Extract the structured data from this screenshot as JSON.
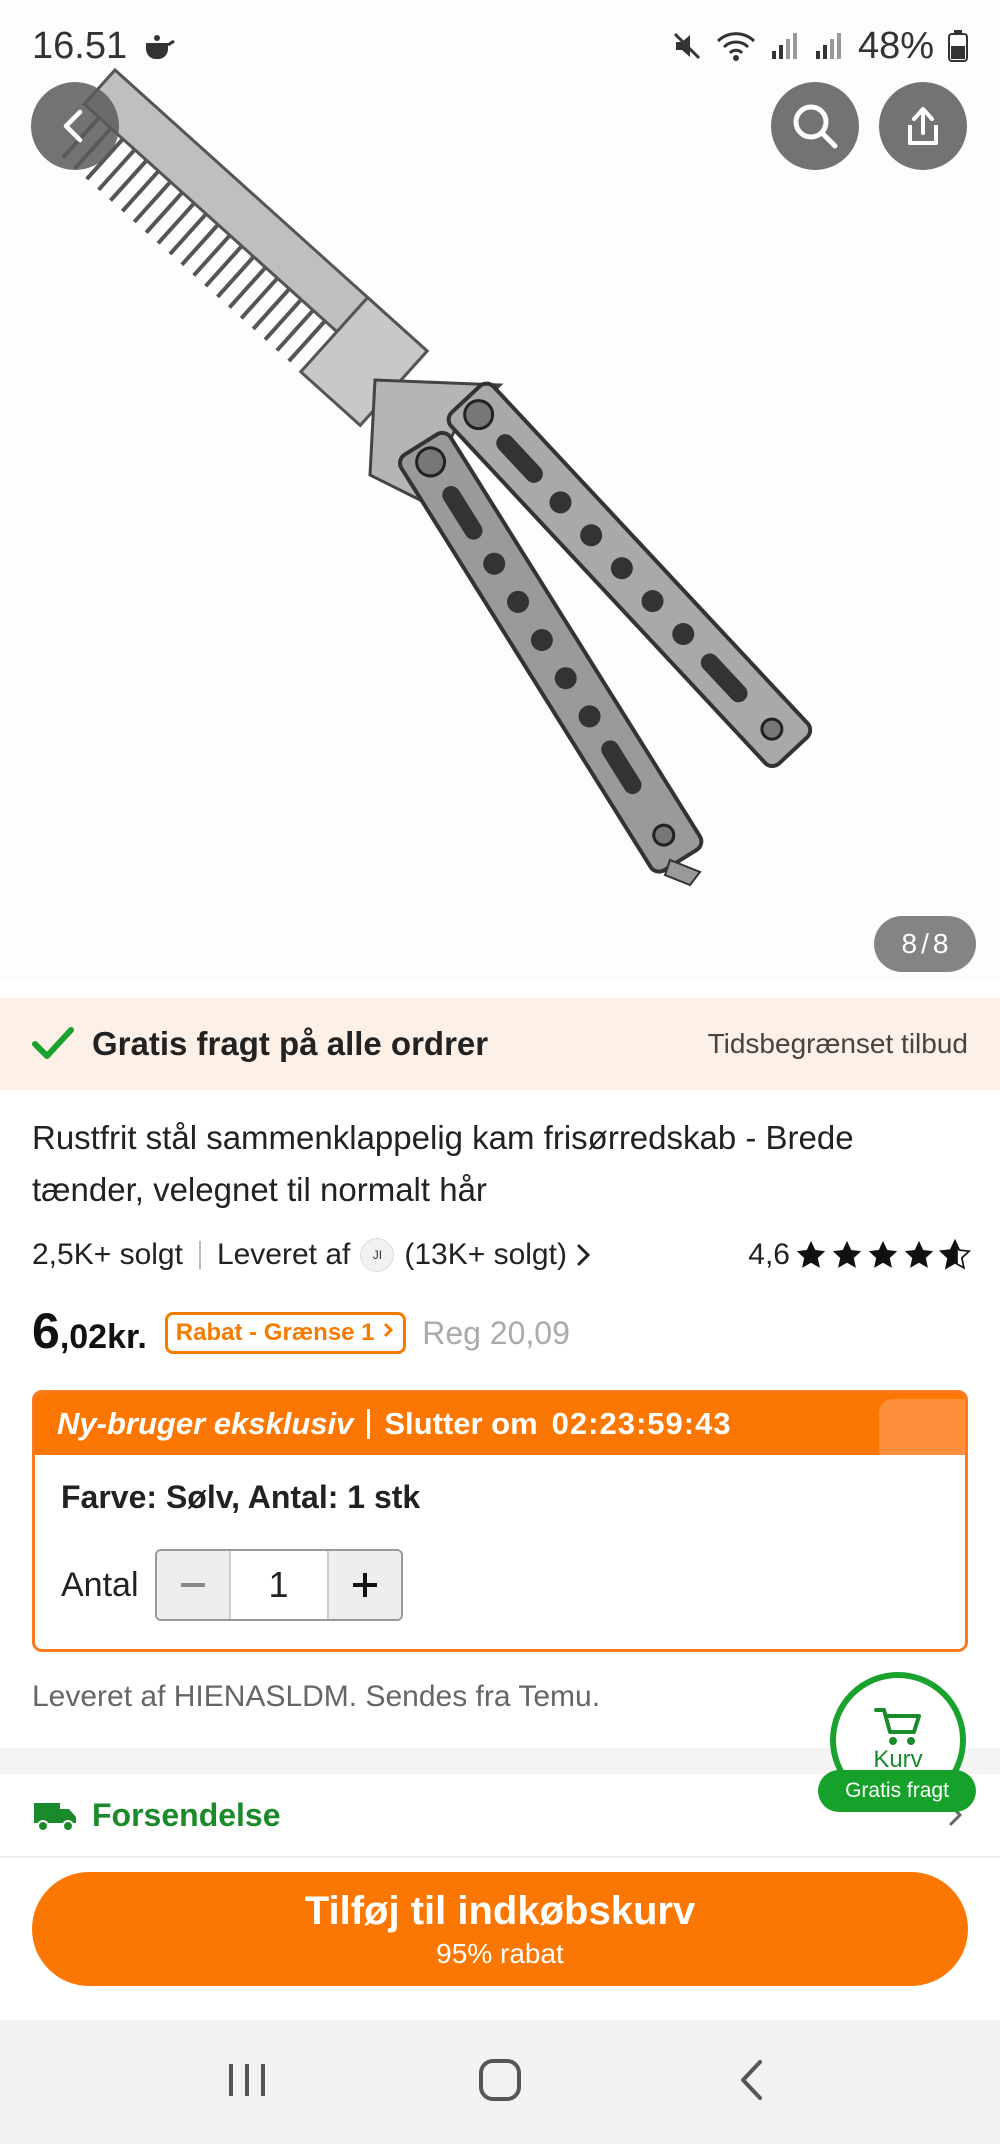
{
  "status_bar": {
    "time": "16.51",
    "battery": "48%"
  },
  "image": {
    "counter_current": "8",
    "counter_sep": "/",
    "counter_total": "8"
  },
  "banner": {
    "main": "Gratis fragt på alle ordrer",
    "side": "Tidsbegrænset tilbud"
  },
  "product": {
    "title": "Rustfrit stål sammenklappelig kam frisørredskab - Brede tænder, velegnet til normalt hår",
    "sold": "2,5K+ solgt",
    "delivered_by": "Leveret af",
    "store_logo": "JI",
    "store_sold": "(13K+ solgt)",
    "rating": "4,6",
    "rating_value": 4.6,
    "price_int": "6",
    "price_dec": ",02kr.",
    "rabat": "Rabat - Grænse 1",
    "reg_price": "Reg 20,09"
  },
  "exclusive": {
    "label": "Ny-bruger eksklusiv",
    "ends": "Slutter om",
    "timer": "02:23:59:43",
    "variant": "Farve: Sølv, Antal: 1 stk",
    "qty_label": "Antal",
    "qty": "1"
  },
  "supplier_text": "Leveret af HIENASLDM. Sendes fra Temu.",
  "cart": {
    "label": "Kurv",
    "badge": "Gratis fragt"
  },
  "shipping": {
    "label": "Forsendelse"
  },
  "add_to_cart": {
    "label": "Tilføj til indkøbskurv",
    "sub": "95% rabat"
  },
  "colors": {
    "accent": "#fb7701",
    "green": "#1aa22e"
  }
}
